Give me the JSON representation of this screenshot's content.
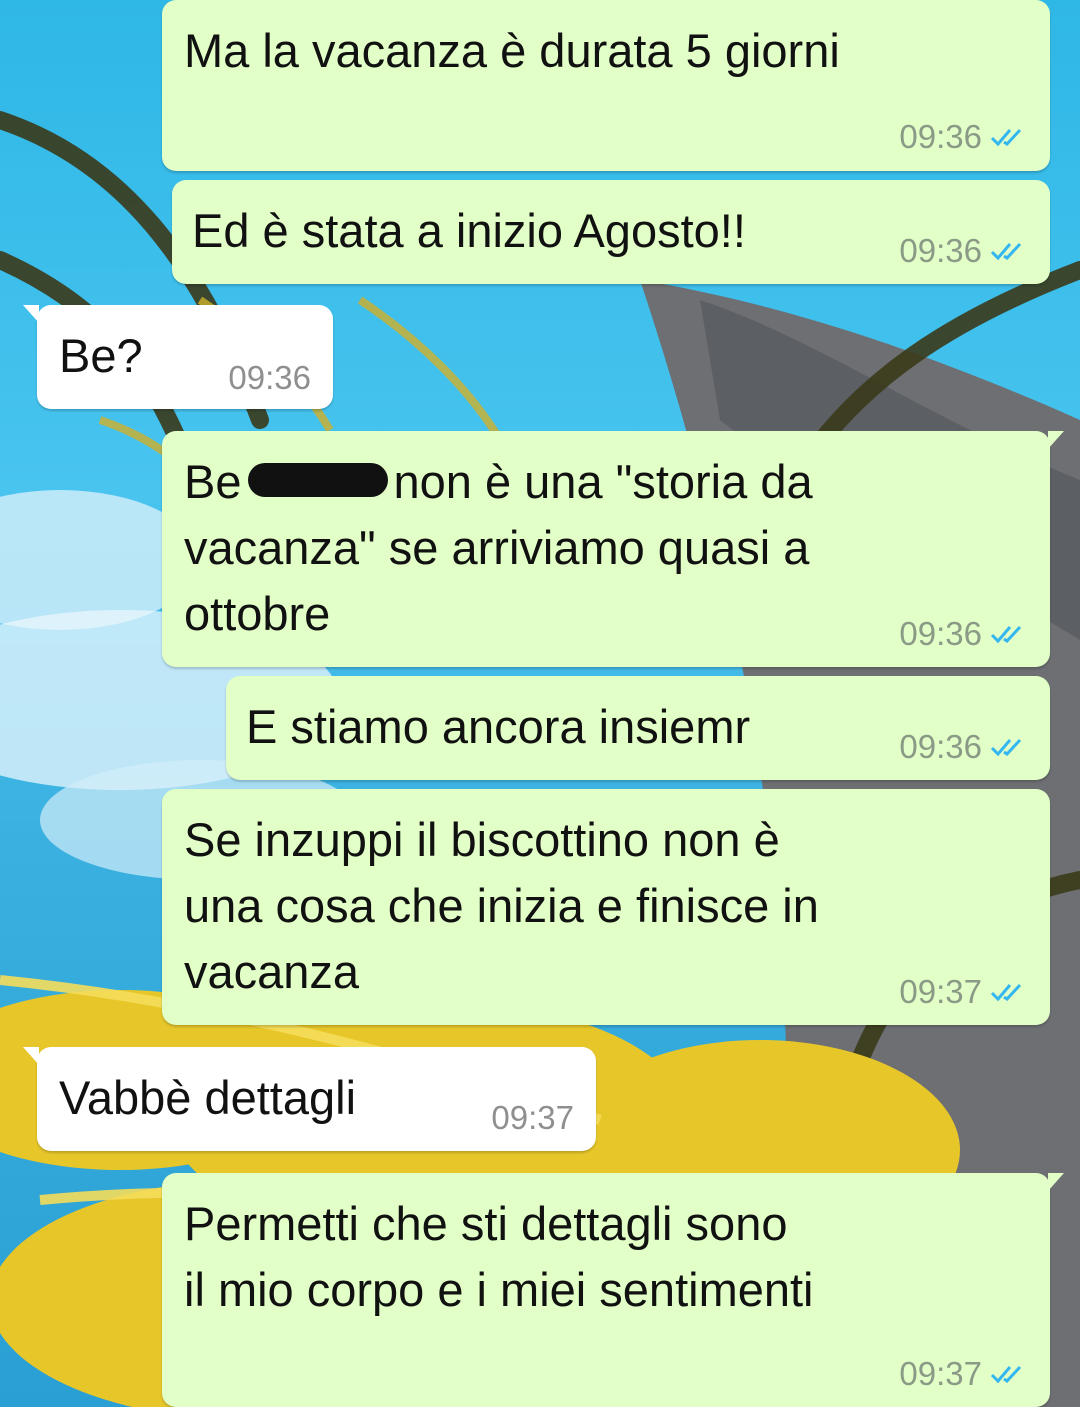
{
  "messages": [
    {
      "direction": "out",
      "text": "Ma la vacanza è durata 5 giorni",
      "time": "09:36",
      "ticks": "double-check-icon"
    },
    {
      "direction": "out",
      "text": "Ed è stata a inizio Agosto!!",
      "time": "09:36",
      "ticks": "double-check-icon"
    },
    {
      "direction": "in",
      "text": "Be?",
      "time": "09:36"
    },
    {
      "direction": "out",
      "text_before": "Be",
      "text_after": "non è una \"storia da\nvacanza\" se arriviamo quasi a\nottobre",
      "time": "09:36",
      "ticks": "double-check-icon"
    },
    {
      "direction": "out",
      "text": "E stiamo ancora insiemr",
      "time": "09:36",
      "ticks": "double-check-icon"
    },
    {
      "direction": "out",
      "text": "Se inzuppi il biscottino non è\nuna cosa che inizia e finisce in\nvacanza",
      "time": "09:37",
      "ticks": "double-check-icon"
    },
    {
      "direction": "in",
      "text": "Vabbè dettagli",
      "time": "09:37"
    },
    {
      "direction": "out",
      "text": "Permetti che sti dettagli sono\nil mio corpo e i miei sentimenti",
      "time": "09:37",
      "ticks": "double-check-icon"
    }
  ],
  "colors": {
    "outgoing_bubble": "#e1ffc7",
    "incoming_bubble": "#ffffff",
    "read_ticks": "#34b7f1",
    "wallpaper_sky": "#3ab8e8"
  }
}
